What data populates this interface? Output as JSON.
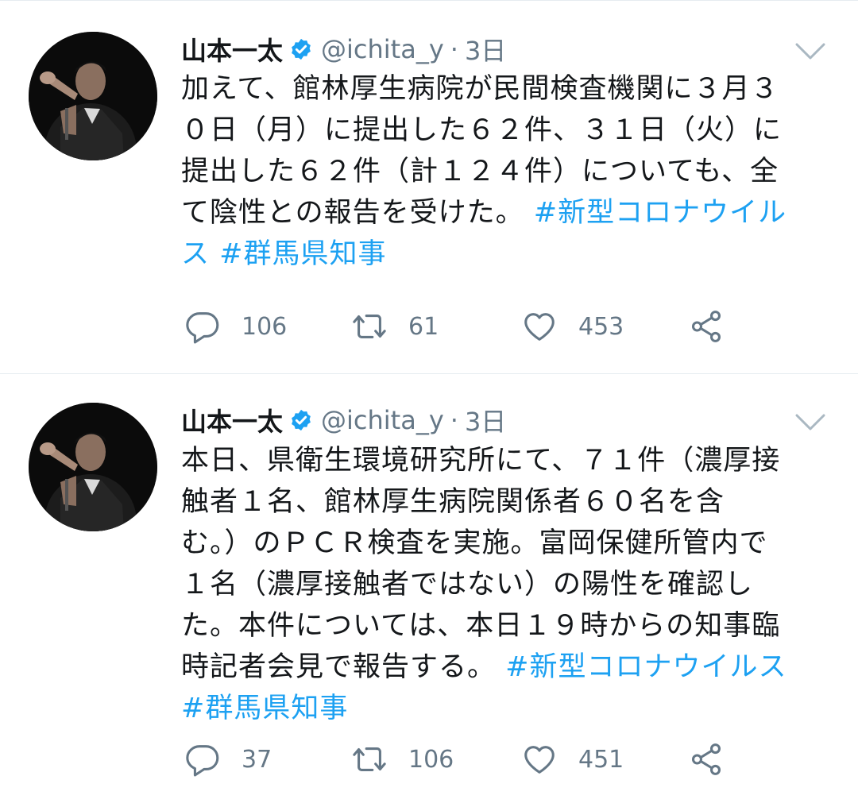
{
  "tweets": [
    {
      "author_name": "山本一太",
      "handle": "@ichita_y",
      "separator": "·",
      "time": "3日",
      "lines": [
        [
          {
            "t": "加えて、館林厚生病院が民間検査機関に３月３"
          }
        ],
        [
          {
            "t": "０日（月）に提出した６２件、３１日（火）に"
          }
        ],
        [
          {
            "t": "提出した６２件（計１２４件）についても、全"
          }
        ],
        [
          {
            "t": "て陰性との報告を受けた。 "
          },
          {
            "t": "#新型コロナウイル",
            "h": true
          }
        ],
        [
          {
            "t": "ス",
            "h": true
          },
          {
            "t": " "
          },
          {
            "t": "#群馬県知事",
            "h": true
          }
        ]
      ],
      "stats": {
        "replies": "106",
        "retweets": "61",
        "likes": "453"
      }
    },
    {
      "author_name": "山本一太",
      "handle": "@ichita_y",
      "separator": "·",
      "time": "3日",
      "lines": [
        [
          {
            "t": "本日、県衛生環境研究所にて、７１件（濃厚接"
          }
        ],
        [
          {
            "t": "触者１名、館林厚生病院関係者６０名を含"
          }
        ],
        [
          {
            "t": "む。）のＰＣＲ検査を実施。富岡保健所管内で"
          }
        ],
        [
          {
            "t": "１名（濃厚接触者ではない）の陽性を確認し"
          }
        ],
        [
          {
            "t": "た。本件については、本日１９時からの知事臨"
          }
        ],
        [
          {
            "t": "時記者会見で報告する。 "
          },
          {
            "t": "#新型コロナウイルス",
            "h": true
          }
        ],
        [
          {
            "t": "#群馬県知事",
            "h": true
          }
        ]
      ],
      "stats": {
        "replies": "37",
        "retweets": "106",
        "likes": "451"
      }
    }
  ],
  "icons": {
    "verified": "verified-badge-icon",
    "menu": "chevron-down-icon",
    "reply": "reply-icon",
    "retweet": "retweet-icon",
    "like": "heart-icon",
    "share": "share-icon"
  },
  "colors": {
    "hashtag": "#1da1f2",
    "verified": "#1da1f2",
    "secondary_text": "#657786",
    "icon": "#657786",
    "divider": "#e6ecf0"
  }
}
